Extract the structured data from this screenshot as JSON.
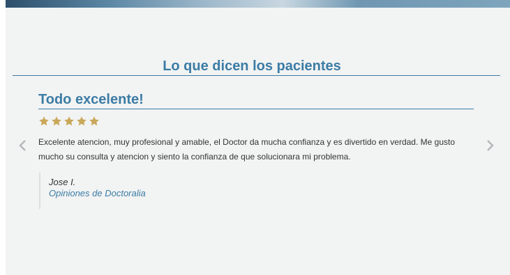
{
  "testimonials": {
    "section_title": "Lo que dicen los pacientes",
    "review": {
      "title": "Todo excelente!",
      "rating": 5,
      "rating_max": 5,
      "text": "Excelente atencion, muy profesional y amable, el Doctor da mucha confianza y es divertido en verdad. Me gusto mucho su consulta y atencion y siento la confianza de que solucionara mi problema.",
      "author": "Jose I.",
      "source": "Opiniones de Doctoralia"
    },
    "nav": {
      "prev_icon": "chevron-left-icon",
      "next_icon": "chevron-right-icon"
    }
  },
  "colors": {
    "accent": "#3b7ca5",
    "star": "#c9a85a",
    "background": "#f2f3f3",
    "text": "#333333"
  }
}
